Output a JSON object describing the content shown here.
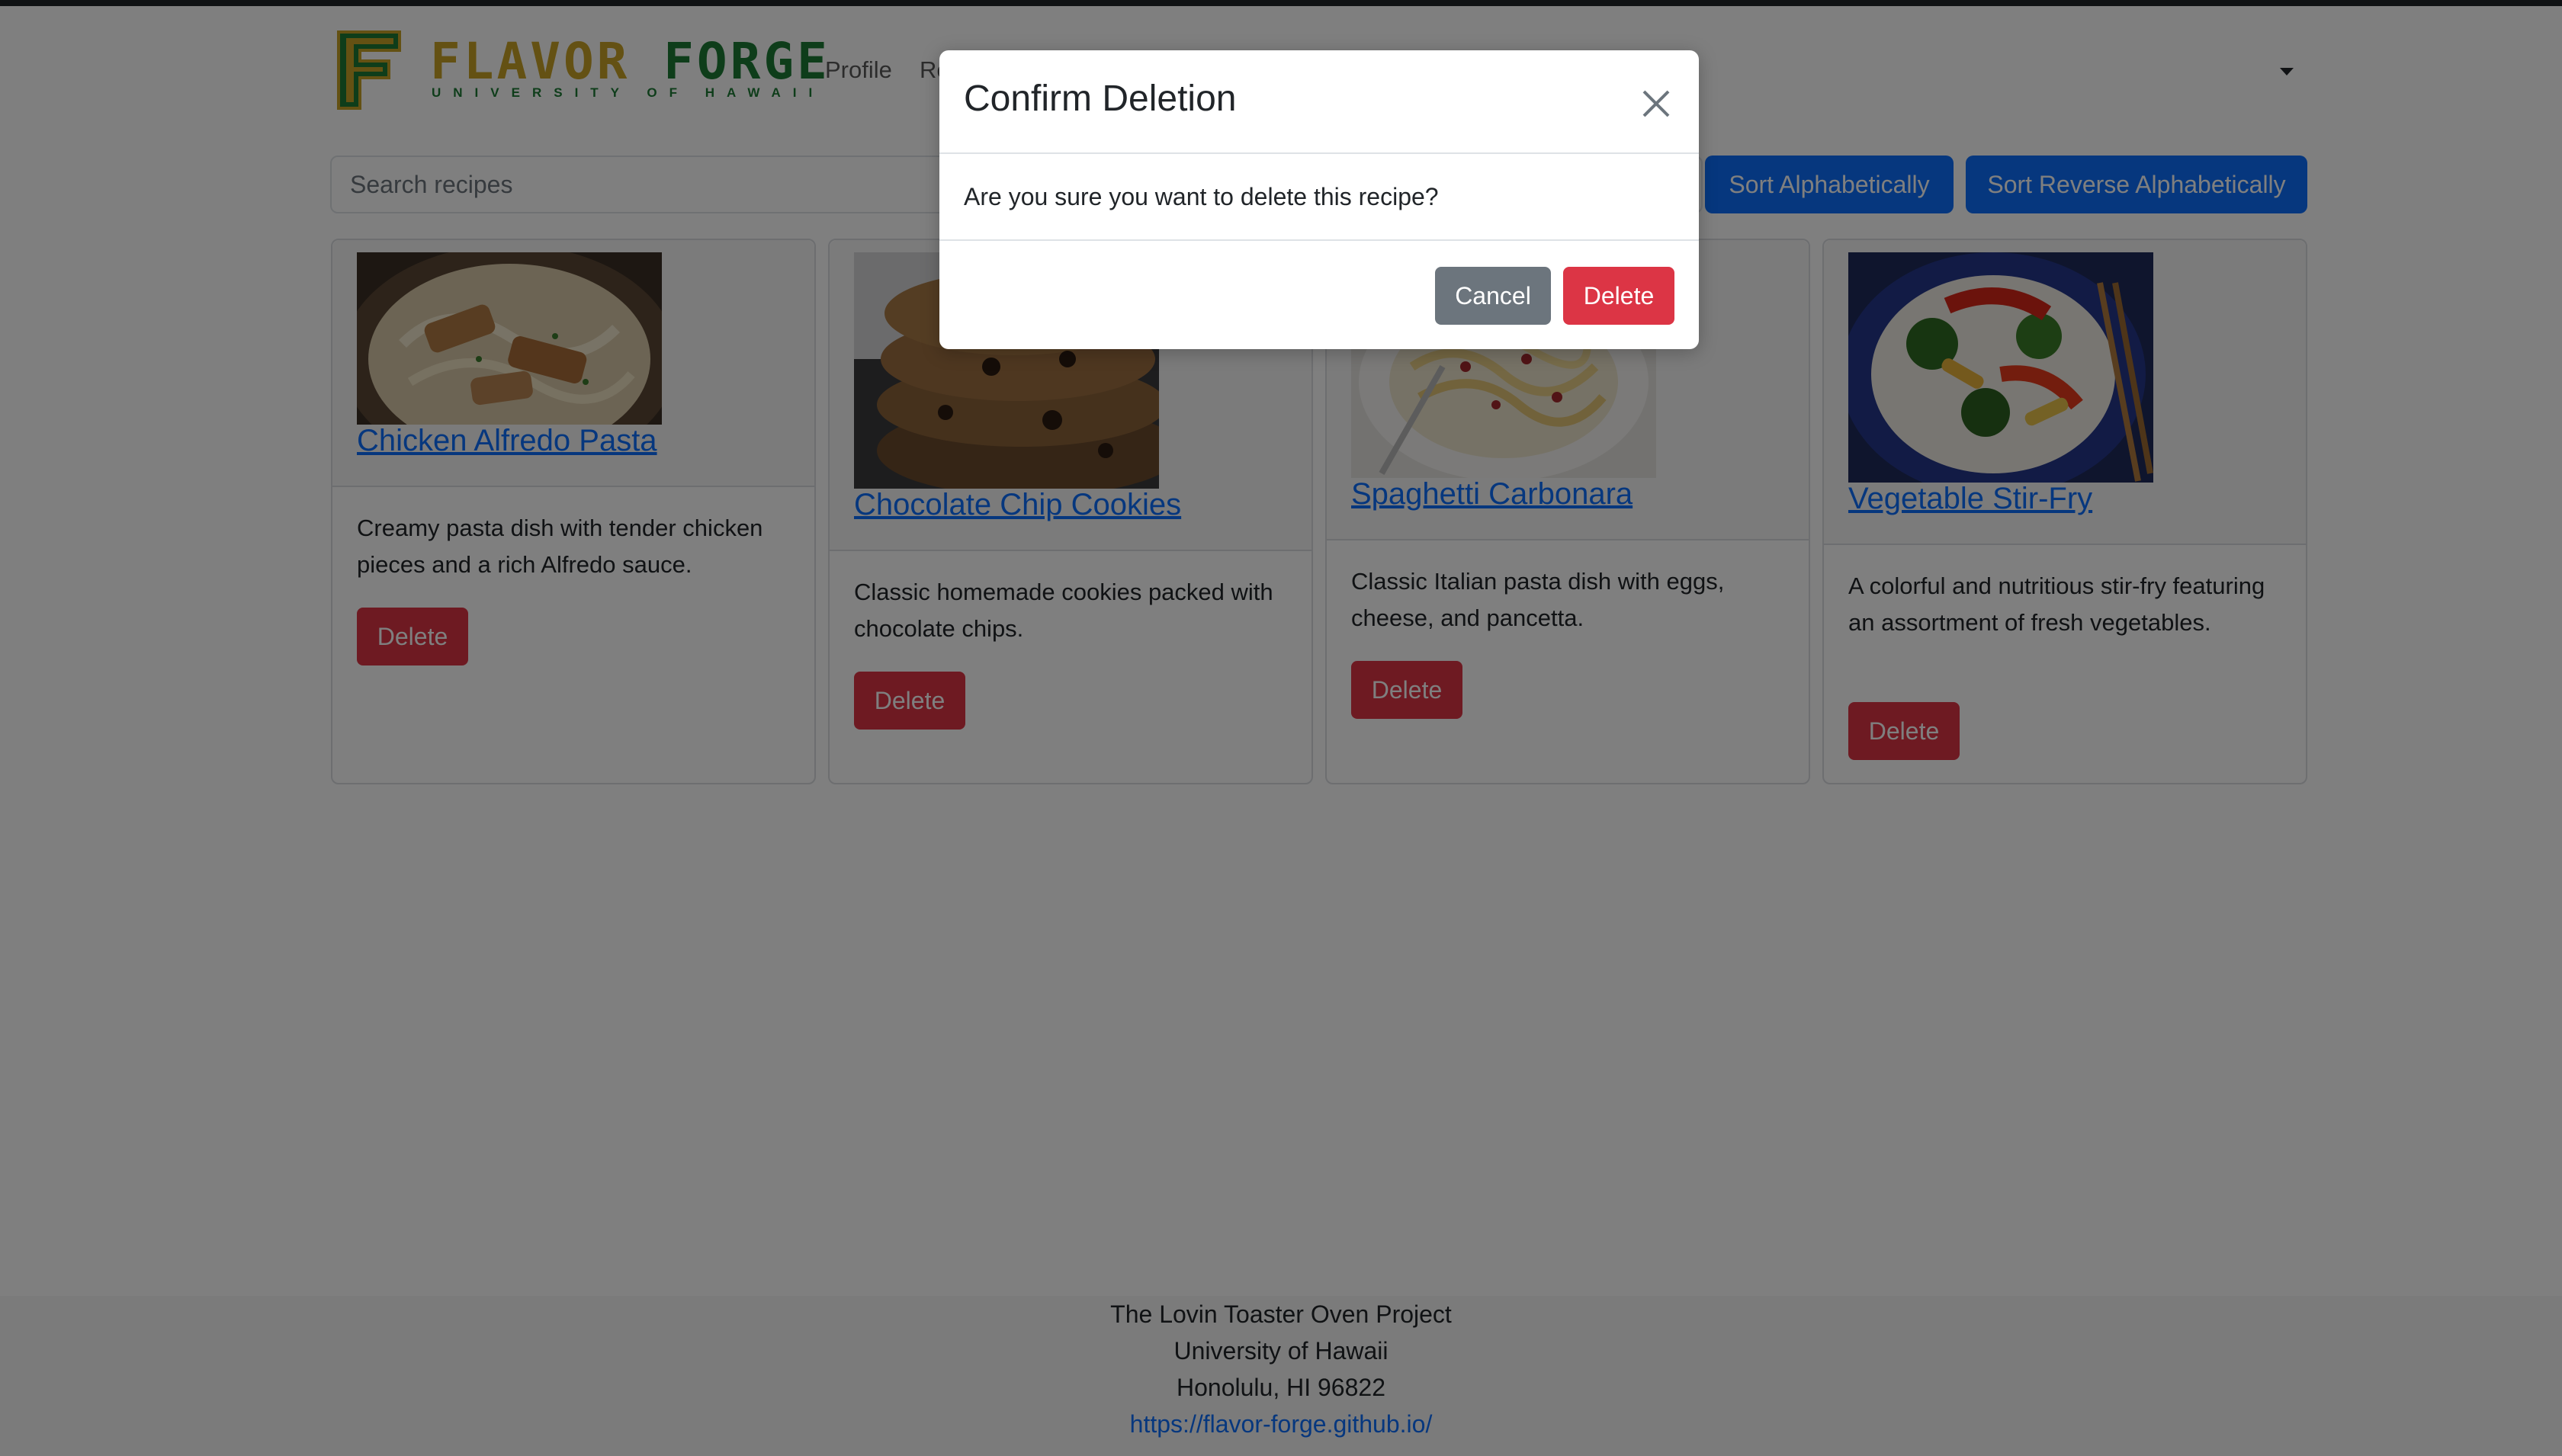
{
  "navbar": {
    "logo_text_1": "FLAVOR",
    "logo_text_2": "FORGE",
    "logo_subtitle": "UNIVERSITY OF HAWAII",
    "links": [
      "Profile",
      "Re"
    ]
  },
  "search": {
    "placeholder": "Search recipes",
    "value": ""
  },
  "sort": {
    "alpha_label": "Sort Alphabetically",
    "reverse_label": "Sort Reverse Alphabetically"
  },
  "recipes": [
    {
      "title": "Chicken Alfredo Pasta",
      "description": "Creamy pasta dish with tender chicken pieces and a rich Alfredo sauce.",
      "delete_label": "Delete"
    },
    {
      "title": "Chocolate Chip Cookies",
      "description": "Classic homemade cookies packed with chocolate chips.",
      "delete_label": "Delete"
    },
    {
      "title": "Spaghetti Carbonara",
      "description": "Classic Italian pasta dish with eggs, cheese, and pancetta.",
      "delete_label": "Delete"
    },
    {
      "title": "Vegetable Stir-Fry",
      "description": "A colorful and nutritious stir-fry featuring an assortment of fresh vegetables.",
      "delete_label": "Delete"
    }
  ],
  "footer": {
    "line1": "The Lovin Toaster Oven Project",
    "line2": "University of Hawaii",
    "line3": "Honolulu, HI 96822",
    "link": "https://flavor-forge.github.io/"
  },
  "modal": {
    "title": "Confirm Deletion",
    "body": "Are you sure you want to delete this recipe?",
    "cancel_label": "Cancel",
    "delete_label": "Delete"
  },
  "colors": {
    "primary": "#0d6efd",
    "danger": "#dc3545",
    "secondary": "#6c757d",
    "logo_gold": "#c9a227",
    "logo_green": "#1c7a35"
  }
}
